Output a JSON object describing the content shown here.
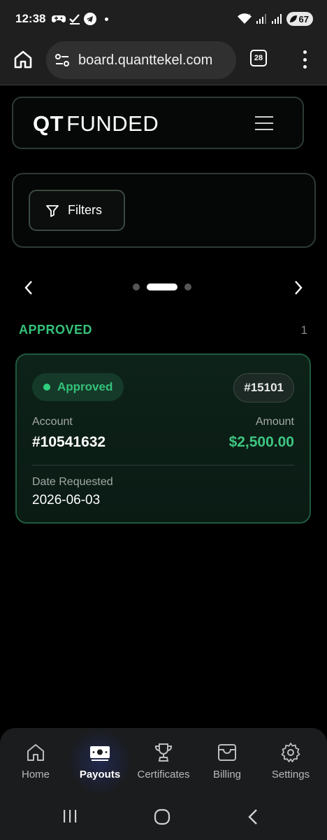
{
  "status_bar": {
    "time": "12:38",
    "battery": "67",
    "icons": [
      "gamepad-icon",
      "check-icon",
      "telegram-icon",
      "wifi-icon",
      "signal-icon",
      "signal-icon"
    ]
  },
  "browser": {
    "url": "board.quanttekel.com",
    "tab_count": "28",
    "icons": [
      "home-icon",
      "tune-icon",
      "tab-switcher-icon",
      "more-vert-icon"
    ]
  },
  "header": {
    "logo_bold": "QT",
    "logo_regular": "FUNDED",
    "menu_icon": "hamburger-icon"
  },
  "filters": {
    "label": "Filters",
    "icon": "filter-funnel-icon"
  },
  "carousel": {
    "pages": 3,
    "active_page": 2
  },
  "section": {
    "title": "APPROVED",
    "count": "1"
  },
  "payout": {
    "status": "Approved",
    "id": "#15101",
    "account_label": "Account",
    "account_value": "#10541632",
    "amount_label": "Amount",
    "amount_value": "$2,500.00",
    "date_label": "Date Requested",
    "date_value": "2026-06-03"
  },
  "bottom_nav": {
    "items": [
      {
        "label": "Home",
        "icon": "home-icon"
      },
      {
        "label": "Payouts",
        "icon": "money-icon"
      },
      {
        "label": "Certificates",
        "icon": "trophy-icon"
      },
      {
        "label": "Billing",
        "icon": "wallet-icon"
      },
      {
        "label": "Settings",
        "icon": "gear-icon"
      }
    ],
    "active": "Payouts"
  },
  "colors": {
    "accent_green": "#34c27a",
    "card_border": "#1f5a3d",
    "background": "#000000"
  }
}
